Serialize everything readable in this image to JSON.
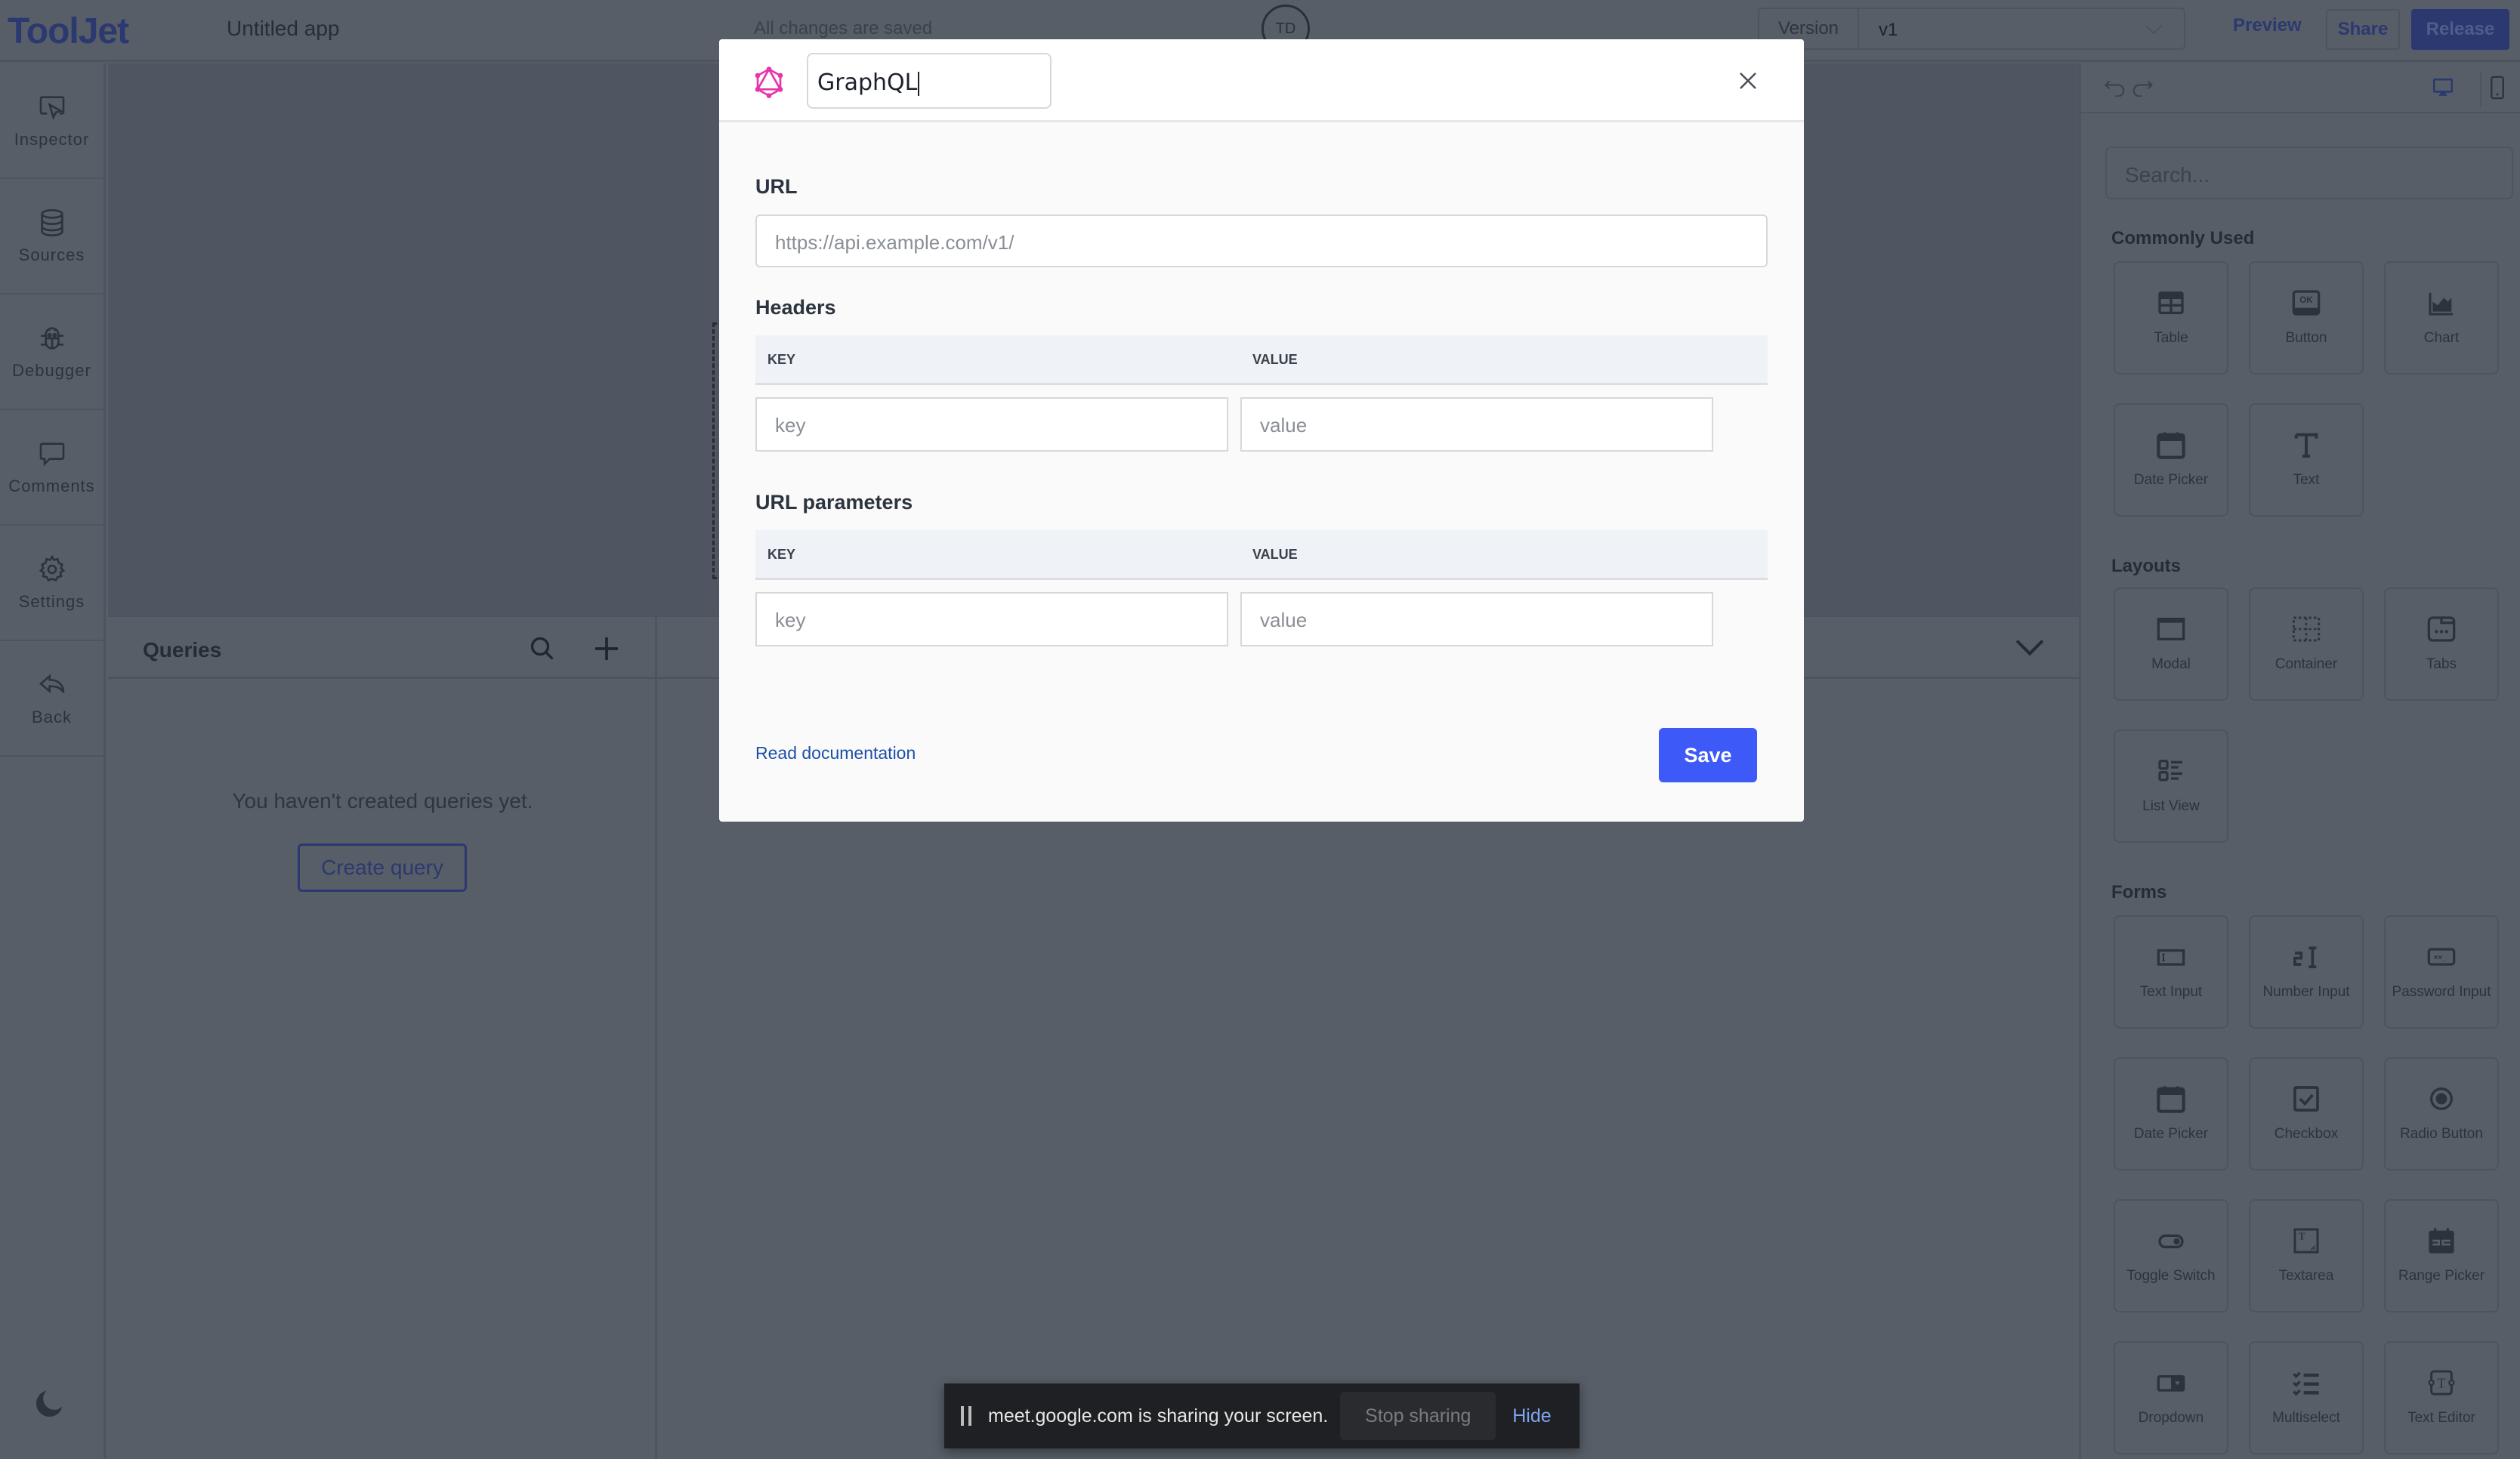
{
  "topbar": {
    "logo": "ToolJet",
    "app_name": "Untitled app",
    "save_status": "All changes are saved",
    "avatar_initials": "TD",
    "version_label": "Version",
    "version_value": "v1",
    "preview": "Preview",
    "share": "Share",
    "release": "Release"
  },
  "sidebar": {
    "items": [
      {
        "label": "Inspector",
        "icon": "inspector-icon"
      },
      {
        "label": "Sources",
        "icon": "database-icon"
      },
      {
        "label": "Debugger",
        "icon": "bug-icon"
      },
      {
        "label": "Comments",
        "icon": "comment-icon"
      },
      {
        "label": "Settings",
        "icon": "gear-icon"
      },
      {
        "label": "Back",
        "icon": "back-arrow-icon"
      }
    ],
    "theme_toggle_icon": "moon-icon"
  },
  "queries": {
    "title": "Queries",
    "empty_message": "You haven't created queries yet.",
    "create_button": "Create query"
  },
  "right_panel": {
    "search_placeholder": "Search...",
    "sections": [
      {
        "title": "Commonly Used",
        "items": [
          "Table",
          "Button",
          "Chart",
          "Date Picker",
          "Text"
        ]
      },
      {
        "title": "Layouts",
        "items": [
          "Modal",
          "Container",
          "Tabs",
          "List View"
        ]
      },
      {
        "title": "Forms",
        "items": [
          "Text Input",
          "Number Input",
          "Password Input",
          "Date Picker",
          "Checkbox",
          "Radio Button",
          "Toggle Switch",
          "Textarea",
          "Range Picker",
          "Dropdown",
          "Multiselect",
          "Text Editor"
        ]
      }
    ]
  },
  "modal": {
    "datasource_name": "GraphQL",
    "url_label": "URL",
    "url_placeholder": "https://api.example.com/v1/",
    "headers_label": "Headers",
    "params_label": "URL parameters",
    "col_key": "KEY",
    "col_value": "VALUE",
    "key_placeholder": "key",
    "value_placeholder": "value",
    "doc_link": "Read documentation",
    "save": "Save",
    "accent_color": "#3d59f7",
    "graphql_color": "#e535ab"
  },
  "screen_share": {
    "message": "meet.google.com is sharing your screen.",
    "stop": "Stop sharing",
    "hide": "Hide"
  }
}
